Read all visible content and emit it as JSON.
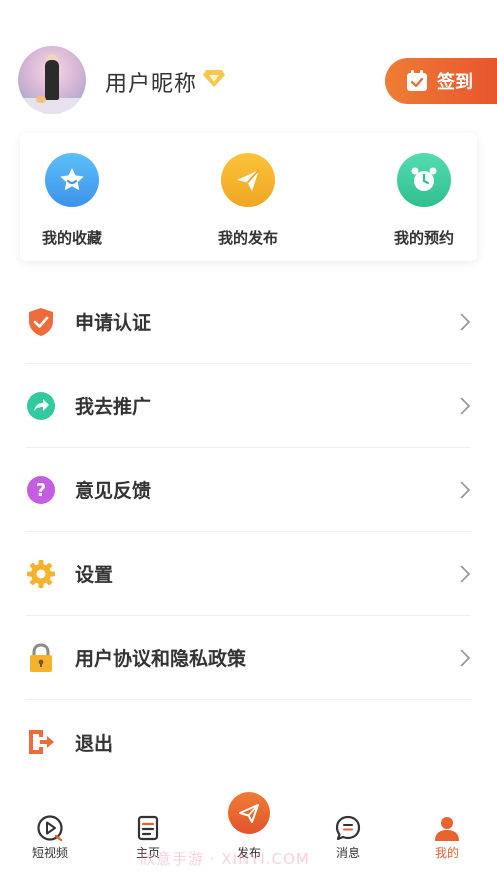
{
  "profile": {
    "nickname": "用户昵称",
    "signin_label": "签到"
  },
  "quick_actions": [
    {
      "label": "我的收藏",
      "icon": "star-icon",
      "color": "#4aa8f0"
    },
    {
      "label": "我的发布",
      "icon": "paper-plane-icon",
      "color": "#f5b22c"
    },
    {
      "label": "我的预约",
      "icon": "alarm-clock-icon",
      "color": "#3fcf9e"
    }
  ],
  "menu": [
    {
      "label": "申请认证",
      "icon": "shield-check-icon",
      "color": "#ee6b3b"
    },
    {
      "label": "我去推广",
      "icon": "share-arrow-icon",
      "color": "#33c9a0"
    },
    {
      "label": "意见反馈",
      "icon": "question-icon",
      "color": "#c45de0"
    },
    {
      "label": "设置",
      "icon": "gear-icon",
      "color": "#f5b22c"
    },
    {
      "label": "用户协议和隐私政策",
      "icon": "lock-icon",
      "color": "#f5b22c"
    },
    {
      "label": "退出",
      "icon": "logout-icon",
      "color": "#ee6b3b"
    }
  ],
  "tabbar": {
    "items": [
      {
        "label": "短视频",
        "icon": "video-play-icon"
      },
      {
        "label": "主页",
        "icon": "document-icon"
      },
      {
        "label": "发布",
        "icon": "paper-plane-icon"
      },
      {
        "label": "消息",
        "icon": "chat-icon"
      },
      {
        "label": "我的",
        "icon": "person-icon"
      }
    ],
    "active": "我的"
  },
  "colors": {
    "accent": "#e8632e",
    "text": "#333333"
  },
  "watermark": "欣意手游 · XINYI.COM"
}
